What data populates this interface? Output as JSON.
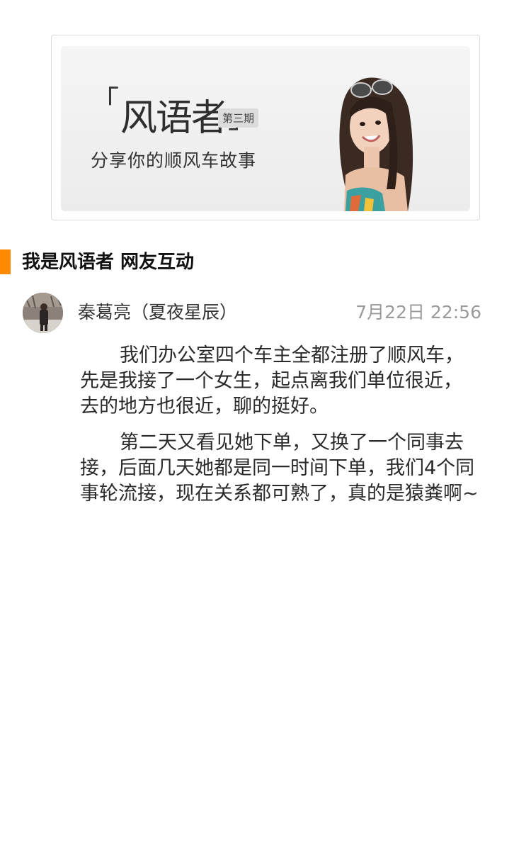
{
  "banner": {
    "open_bracket": "「",
    "title": "风语者",
    "close_bracket": "」",
    "issue": "第三期",
    "subtitle": "分享你的顺风车故事",
    "portrait_icon": "woman-portrait"
  },
  "section": {
    "title": "我是风语者 网友互动",
    "accent_color": "#ff8a00"
  },
  "post": {
    "avatar_icon": "user-avatar",
    "username": "秦葛亮（夏夜星辰）",
    "timestamp": "7月22日 22:56",
    "paragraphs": [
      "我们办公室四个车主全都注册了顺风车，先是我接了一个女生，起点离我们单位很近，去的地方也很近，聊的挺好。",
      "第二天又看见她下单，又换了一个同事去接，后面几天她都是同一时间下单，我们4个同事轮流接，现在关系都可熟了，真的是猿粪啊~"
    ]
  }
}
